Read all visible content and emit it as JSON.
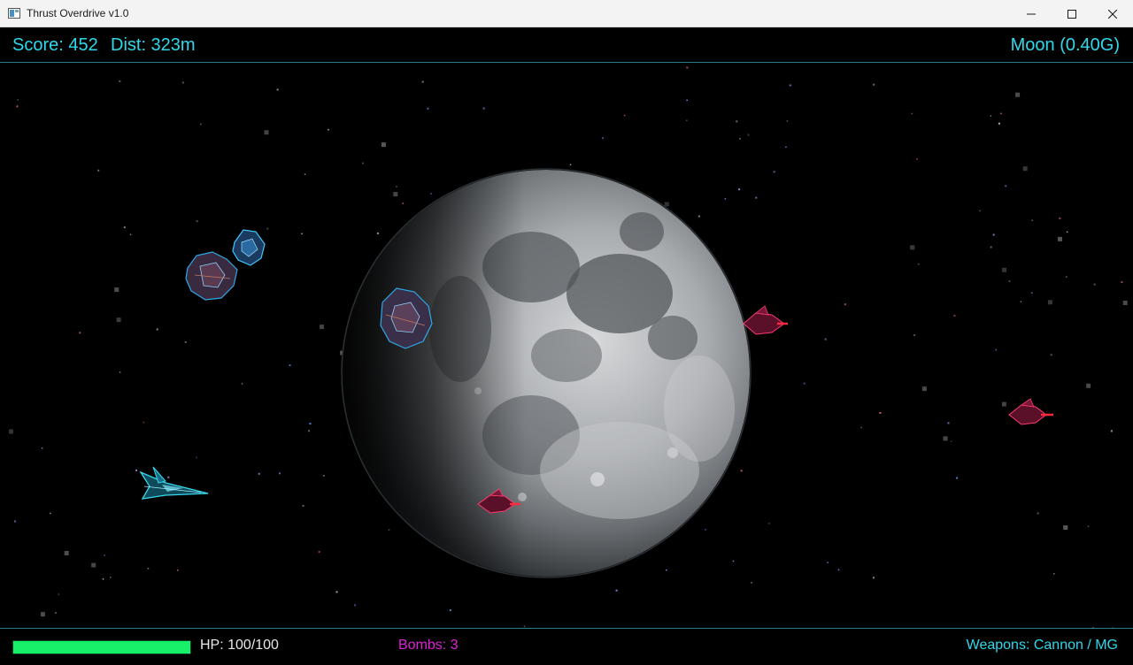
{
  "window": {
    "title": "Thrust Overdrive v1.0",
    "controls": [
      "minimize-icon",
      "maximize-icon",
      "close-icon"
    ]
  },
  "hud": {
    "score": "Score: 452",
    "distance": "Dist: 323m",
    "planet": "Moon (0.40G)",
    "hp_label": "HP: 100/100",
    "hp_fraction": 1.0,
    "bombs": "Bombs: 3",
    "weapons": "Weapons: Cannon / MG"
  },
  "colors": {
    "hud_cyan": "#2fd8ec",
    "hp_green": "#19f06a",
    "bombs_magenta": "#e01fd8",
    "divider": "#2a7f8f"
  },
  "scene": {
    "background": "starfield",
    "planet": "moon",
    "player": "player-ship",
    "enemies": [
      "enemy-fighter",
      "enemy-fighter",
      "enemy-fighter"
    ],
    "asteroids": [
      "asteroid",
      "asteroid",
      "asteroid"
    ]
  }
}
